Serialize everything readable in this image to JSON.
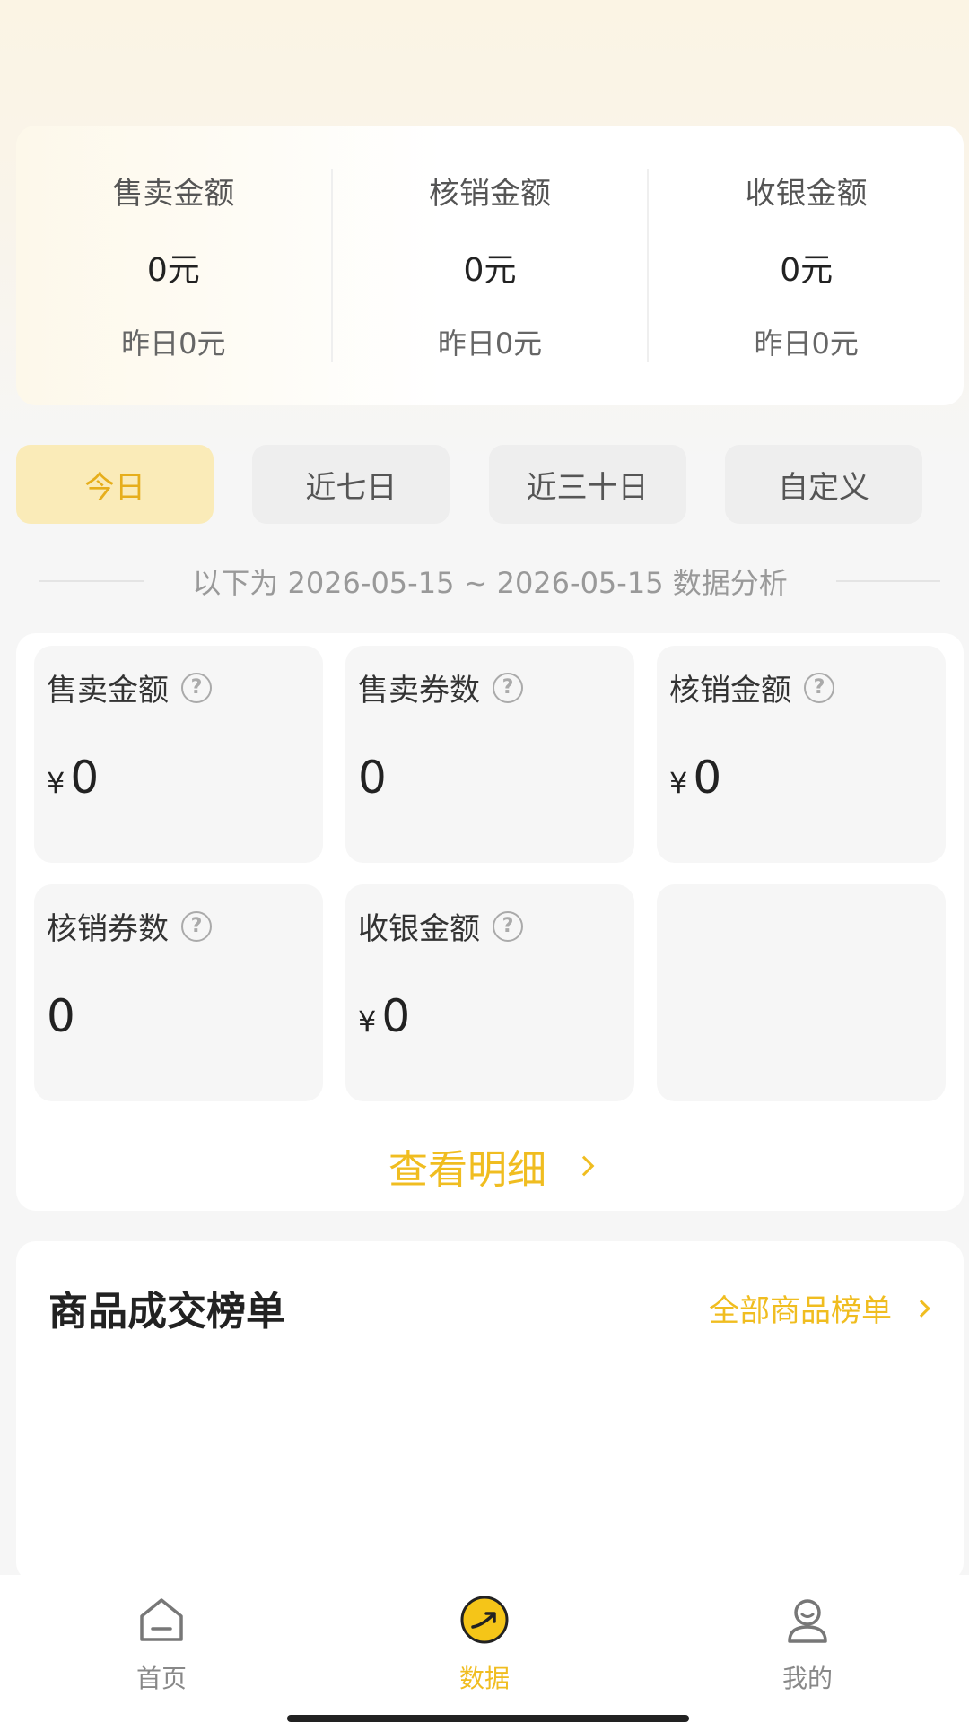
{
  "summary": [
    {
      "label": "售卖金额",
      "value": "0元",
      "yesterday": "昨日0元"
    },
    {
      "label": "核销金额",
      "value": "0元",
      "yesterday": "昨日0元"
    },
    {
      "label": "收银金额",
      "value": "0元",
      "yesterday": "昨日0元"
    }
  ],
  "tabs": [
    {
      "label": "今日",
      "active": true
    },
    {
      "label": "近七日",
      "active": false
    },
    {
      "label": "近三十日",
      "active": false
    },
    {
      "label": "自定义",
      "active": false
    }
  ],
  "range_text": "以下为 2026-05-15 ~ 2026-05-15 数据分析",
  "metrics": [
    {
      "label": "售卖金额",
      "currency": "¥",
      "value": "0"
    },
    {
      "label": "售卖券数",
      "currency": "",
      "value": "0"
    },
    {
      "label": "核销金额",
      "currency": "¥",
      "value": "0"
    },
    {
      "label": "核销券数",
      "currency": "",
      "value": "0"
    },
    {
      "label": "收银金额",
      "currency": "¥",
      "value": "0"
    }
  ],
  "help_glyph": "?",
  "detail_link": "查看明细",
  "ranking": {
    "title": "商品成交榜单",
    "link": "全部商品榜单"
  },
  "nav": [
    {
      "label": "首页",
      "icon": "home-icon",
      "active": false
    },
    {
      "label": "数据",
      "icon": "data-icon",
      "active": true
    },
    {
      "label": "我的",
      "icon": "profile-icon",
      "active": false
    }
  ],
  "colors": {
    "accent": "#f0bd20",
    "tab_active_bg": "#faebb8",
    "tab_active_text": "#e6ae1b"
  }
}
